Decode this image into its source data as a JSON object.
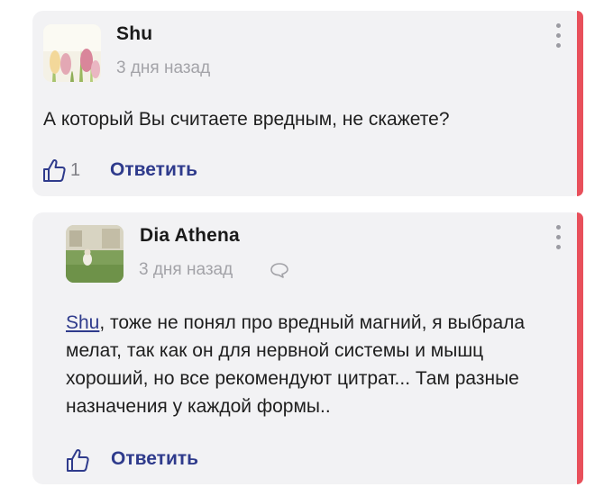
{
  "comments": [
    {
      "author": "Shu",
      "date": "3 дня назад",
      "text": "А который Вы считаете вредным, не скажете?",
      "likes": "1",
      "reply_label": "Ответить"
    },
    {
      "author": "Dia Athena",
      "date": "3 дня назад",
      "mention": "Shu",
      "text_after_mention": ", тоже не понял про вредный магний, я выбрала мелат, так как он для нервной системы и мышц хороший, но все рекомендуют цитрат... Там разные назначения у каждой формы..",
      "reply_label": "Ответить"
    }
  ],
  "colors": {
    "accent": "#e8505b",
    "link": "#2f3b8c",
    "card_bg": "#f2f2f4",
    "muted": "#a3a3a8"
  },
  "icons": [
    "thumbs-up-icon",
    "speech-bubble-icon",
    "more-vertical-icon"
  ]
}
